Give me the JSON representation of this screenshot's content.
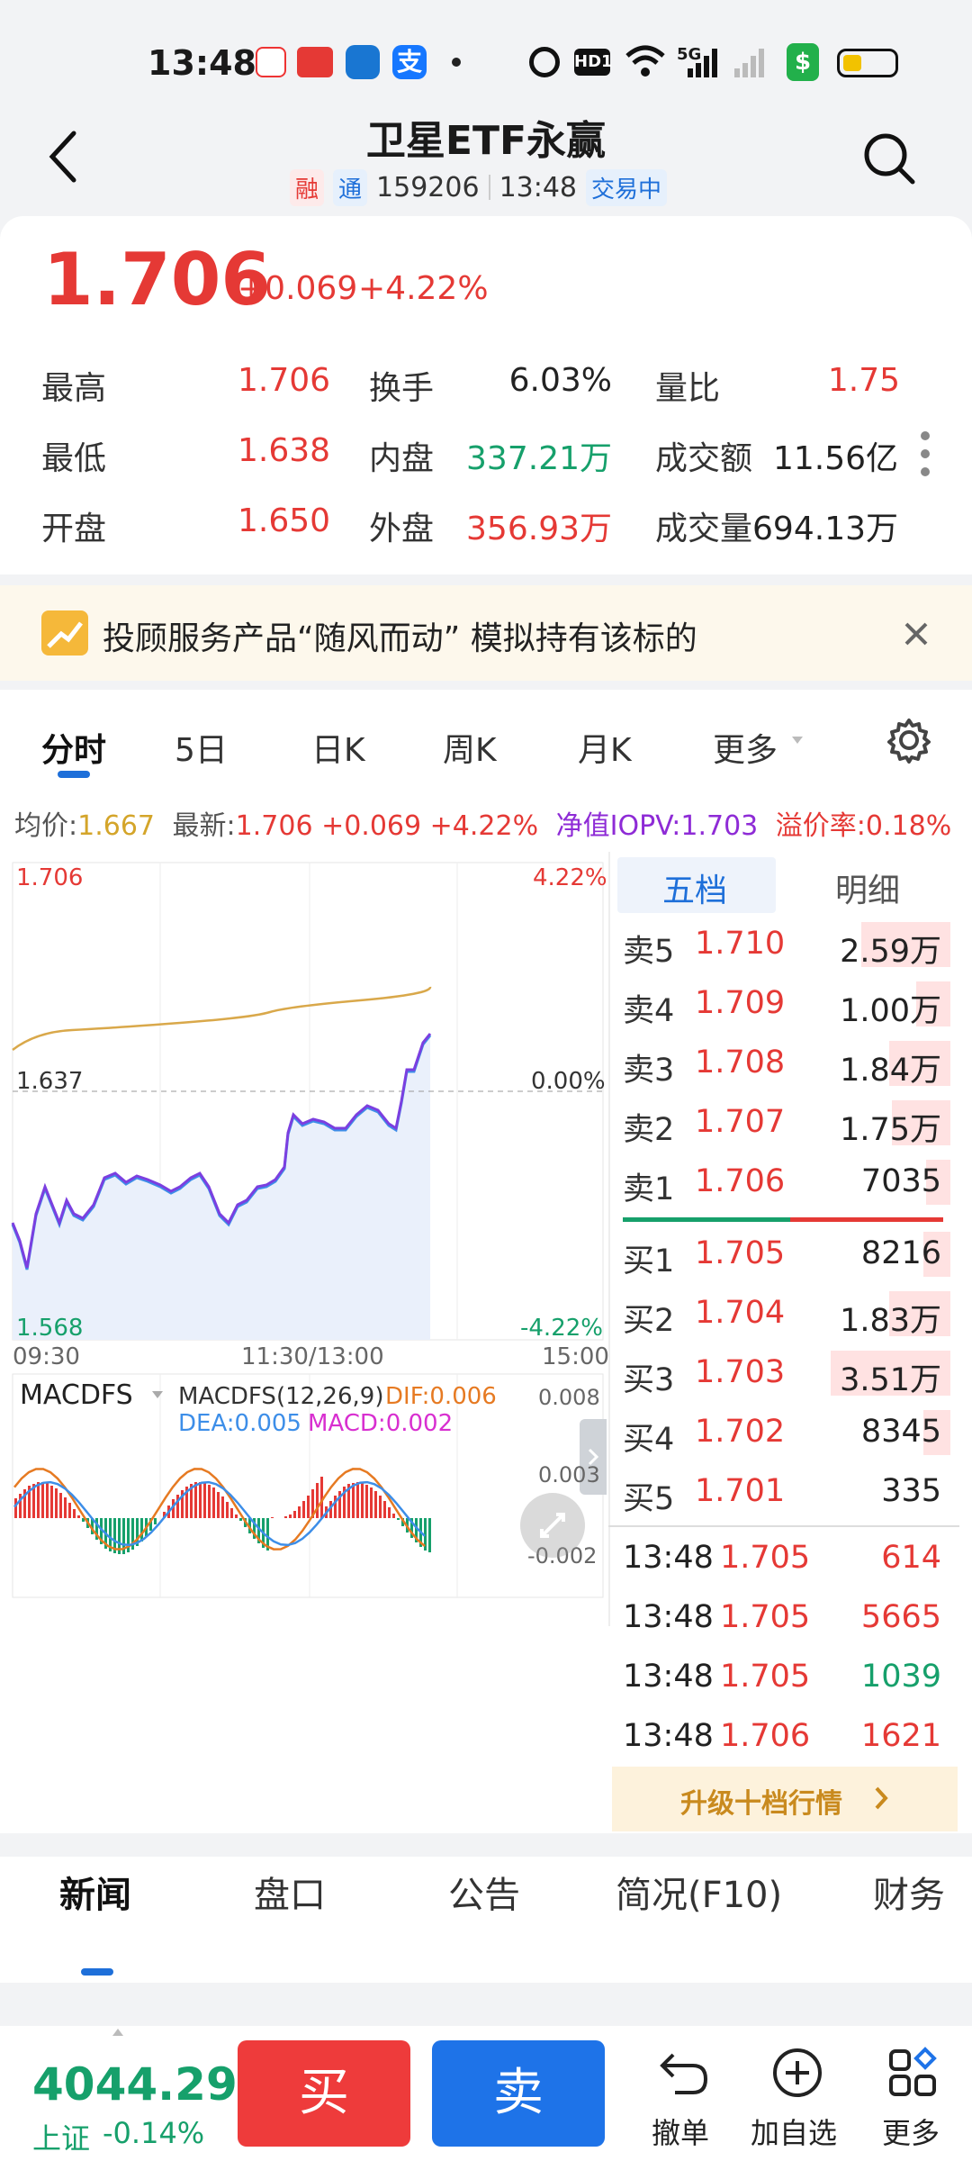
{
  "status": {
    "time": "13:48",
    "signal": "5G",
    "hd": "HD1"
  },
  "header": {
    "title": "卫星ETF永赢",
    "tag_rong": "融",
    "tag_tong": "通",
    "code": "159206",
    "time": "13:48",
    "state": "交易中"
  },
  "price": {
    "last": "1.706",
    "change": "+0.069",
    "pct": "+4.22%"
  },
  "stats": [
    {
      "l1": "最高",
      "v1": "1.706",
      "l2": "换手",
      "v2": "6.03%",
      "l3": "量比",
      "v3": "1.75"
    },
    {
      "l1": "最低",
      "v1": "1.638",
      "l2": "内盘",
      "v2": "337.21万",
      "l3": "成交额",
      "v3": "11.56亿"
    },
    {
      "l1": "开盘",
      "v1": "1.650",
      "l2": "外盘",
      "v2": "356.93万",
      "l3": "成交量",
      "v3": "694.13万"
    }
  ],
  "banner": {
    "text": "投顾服务产品“随风而动” 模拟持有该标的"
  },
  "chart_tabs": [
    "分时",
    "5日",
    "日K",
    "周K",
    "月K",
    "更多"
  ],
  "infoline": {
    "avg_label": "均价:",
    "avg": "1.667",
    "latest_label": "最新:",
    "latest": "1.706 +0.069 +4.22%",
    "iopv": "净值IOPV:1.703",
    "premium": "溢价率:0.18%"
  },
  "chart_labels": {
    "top_price": "1.706",
    "top_pct": "4.22%",
    "mid_price": "1.637",
    "mid_pct": "0.00%",
    "bot_price": "1.568",
    "bot_pct": "-4.22%",
    "t_start": "09:30",
    "t_mid": "11:30/13:00",
    "t_end": "15:00"
  },
  "macd": {
    "name": "MACDFS",
    "params": "MACDFS(12,26,9)",
    "dif": "DIF:0.006",
    "dea": "DEA:0.005",
    "macd": "MACD:0.002",
    "y_top": "0.008",
    "y_mid": "0.003",
    "y_bot": "-0.002"
  },
  "orderbook_tabs": [
    "五档",
    "明细"
  ],
  "asks": [
    {
      "label": "卖5",
      "price": "1.710",
      "vol": "2.59万",
      "fill": 0.26
    },
    {
      "label": "卖4",
      "price": "1.709",
      "vol": "1.00万",
      "fill": 0.1
    },
    {
      "label": "卖3",
      "price": "1.708",
      "vol": "1.84万",
      "fill": 0.18
    },
    {
      "label": "卖2",
      "price": "1.707",
      "vol": "1.75万",
      "fill": 0.17
    },
    {
      "label": "卖1",
      "price": "1.706",
      "vol": "7035",
      "fill": 0.07
    }
  ],
  "bids": [
    {
      "label": "买1",
      "price": "1.705",
      "vol": "8216",
      "fill": 0.08
    },
    {
      "label": "买2",
      "price": "1.704",
      "vol": "1.83万",
      "fill": 0.18
    },
    {
      "label": "买3",
      "price": "1.703",
      "vol": "3.51万",
      "fill": 0.35
    },
    {
      "label": "买4",
      "price": "1.702",
      "vol": "8345",
      "fill": 0.08
    },
    {
      "label": "买5",
      "price": "1.701",
      "vol": "335",
      "fill": 0
    }
  ],
  "ticks": [
    {
      "time": "13:48",
      "price": "1.705",
      "vol": "614",
      "color": "#e53935"
    },
    {
      "time": "13:48",
      "price": "1.705",
      "vol": "5665",
      "color": "#e53935"
    },
    {
      "time": "13:48",
      "price": "1.705",
      "vol": "1039",
      "color": "#16a06b"
    },
    {
      "time": "13:48",
      "price": "1.706",
      "vol": "1621",
      "color": "#e53935"
    }
  ],
  "upgrade": "升级十档行情",
  "bottom_tabs": [
    "新闻",
    "盘口",
    "公告",
    "简况(F10)",
    "财务"
  ],
  "index": {
    "value": "4044.29",
    "name": "上证",
    "pct": "-0.14%"
  },
  "actions": {
    "buy": "买",
    "sell": "卖",
    "cancel": "撤单",
    "add": "加自选",
    "more": "更多"
  }
}
